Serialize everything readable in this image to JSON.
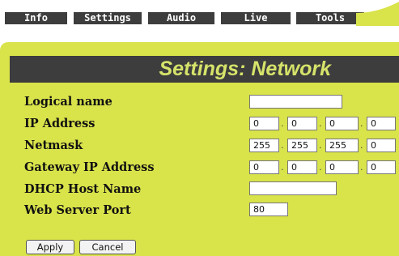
{
  "tabs": [
    "Info",
    "Settings",
    "Audio",
    "Live",
    "Tools"
  ],
  "page_title": "Settings: Network",
  "form": {
    "logical_name": {
      "label": "Logical name",
      "value": ""
    },
    "ip_address": {
      "label": "IP Address",
      "octets": [
        "0",
        "0",
        "0",
        "0"
      ]
    },
    "netmask": {
      "label": "Netmask",
      "octets": [
        "255",
        "255",
        "255",
        "0"
      ]
    },
    "gateway": {
      "label": "Gateway IP Address",
      "octets": [
        "0",
        "0",
        "0",
        "0"
      ]
    },
    "dhcp_host_name": {
      "label": "DHCP Host Name",
      "value": ""
    },
    "web_server_port": {
      "label": "Web Server Port",
      "value": "80"
    }
  },
  "buttons": {
    "apply": "Apply",
    "cancel": "Cancel"
  },
  "colors": {
    "tab_bg": "#3d3d3d",
    "panel_bg": "#d9e34a",
    "title_text": "#d6e36a"
  }
}
